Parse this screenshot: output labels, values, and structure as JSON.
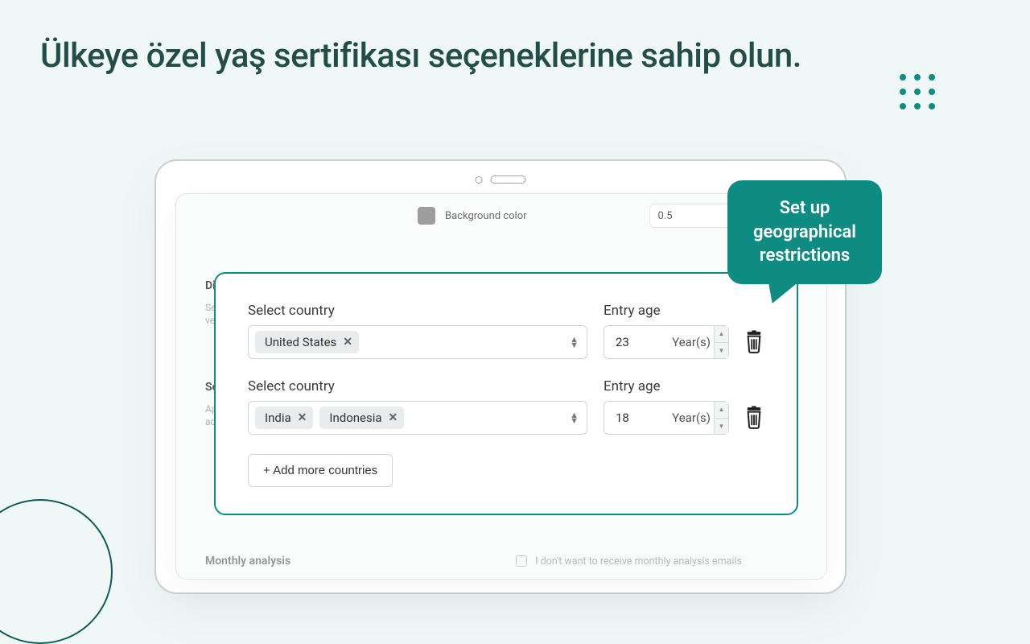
{
  "headline": "Ülkeye özel yaş sertifikası seçeneklerine sahip olun.",
  "bubble": "Set up geographical restrictions",
  "background_row": {
    "label": "Background color",
    "value": "0.5"
  },
  "back_card": {
    "section1_title": "Dis",
    "section1_desc1": "Se",
    "section1_desc2": "ve",
    "section2_title": "Se",
    "section2_desc1": "Ap",
    "section2_desc2": "ac",
    "monthly_label": "Monthly analysis",
    "monthly_checkbox": "I don't want to receive monthly analysis emails"
  },
  "modal": {
    "rows": [
      {
        "country_label": "Select country",
        "chips": [
          "United States"
        ],
        "age_label": "Entry age",
        "age_value": "23",
        "age_unit": "Year(s)"
      },
      {
        "country_label": "Select country",
        "chips": [
          "India",
          "Indonesia"
        ],
        "age_label": "Entry age",
        "age_value": "18",
        "age_unit": "Year(s)"
      }
    ],
    "add_button": "+ Add more countries"
  }
}
